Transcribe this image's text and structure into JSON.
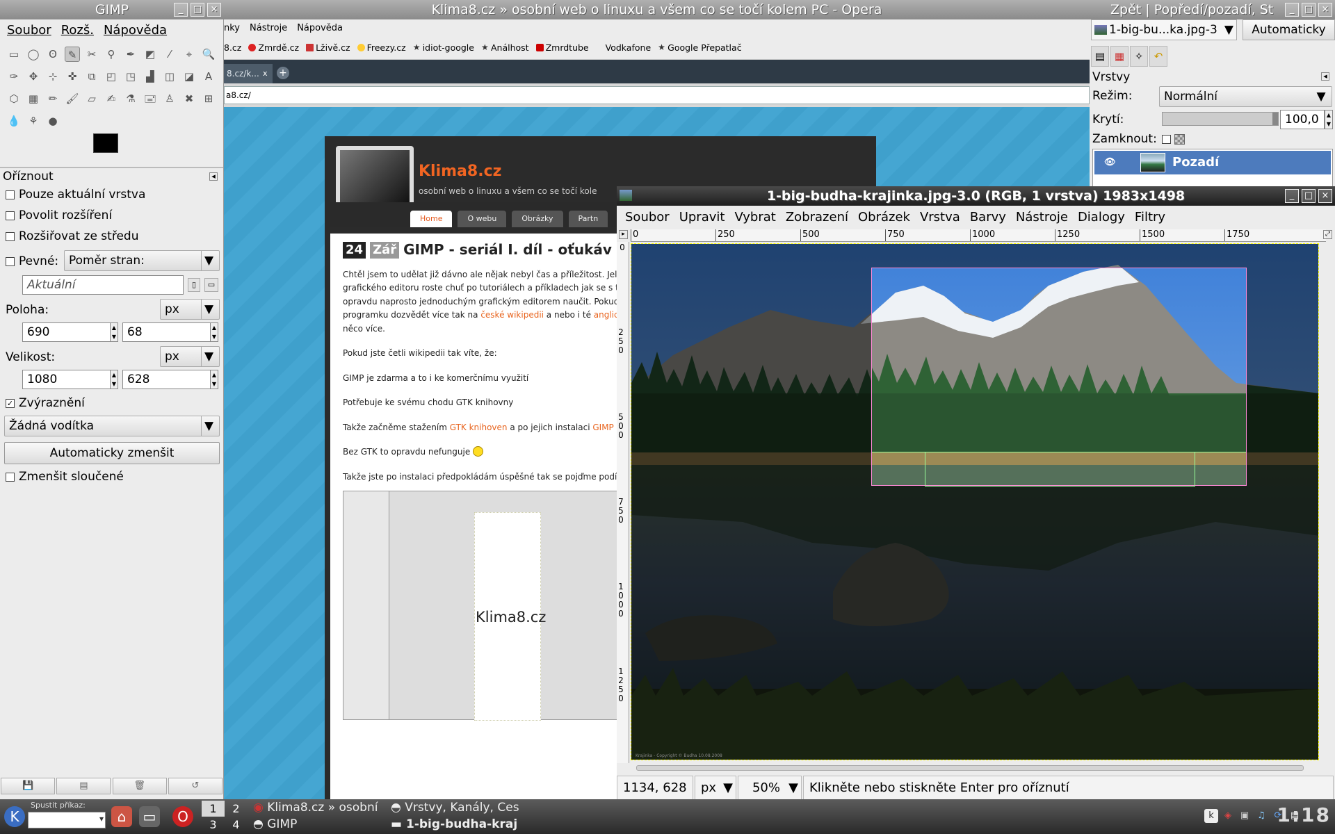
{
  "opera": {
    "title": "Klima8.cz » osobní web o linuxu a všem co se točí kolem PC - Opera",
    "menu": [
      "nky",
      "Nástroje",
      "Nápověda"
    ],
    "bookmarks": [
      "8.cz",
      "Zmrdě.cz",
      "Lživě.cz",
      "Freezy.cz",
      "idiot-google",
      "Análhost",
      "Zmrdtube",
      "Vodkafone",
      "Google Přepatlač"
    ],
    "tab_label": "8.cz/k...",
    "tab_close": "x",
    "new_tab": "+",
    "url": "a8.cz/",
    "site": {
      "title": "Klima8.cz",
      "subtitle": "osobní web o linuxu a všem co se točí kole",
      "nav": [
        "Home",
        "O webu",
        "Obrázky",
        "Partn"
      ],
      "post_day": "24",
      "post_month": "Zář",
      "post_title": "GIMP - seriál I. díl - oťukáv",
      "p1": "Chtěl jsem to udělat již dávno ale nějak nebyl čas a příležitost. Jeli",
      "p2": "grafického editoru roste chuť po tutoriálech a příkladech jak se s tím",
      "p3": "opravdu naprosto jednoduchým grafickým editorem naučit. Pokud s",
      "p4a": "programku dozvědět více tak na ",
      "p4link": "české wikipedii",
      "p4b": " a nebo i té ",
      "p4link2": "anglick",
      "p5": "něco více.",
      "p6": "Pokud jste četli wikipedii tak víte, že:",
      "p7": "GIMP je zdarma a to i ke komerčnímu využití",
      "p8": "Potřebuje ke svému chodu GTK knihovny",
      "p9a": "Takže začněme stažením ",
      "p9link": "GTK knihoven",
      "p9b": " a po jejich instalaci ",
      "p9link2": "GIMP",
      "p10": "Bez GTK to opravdu nefunguje",
      "p11": "Takže jste po instalaci předpokládám úspěšné tak se pojďme podív",
      "shot_text": "Klima8.cz"
    }
  },
  "toolbox": {
    "title": "GIMP",
    "menu": [
      "Soubor",
      "Rozš.",
      "Nápověda"
    ],
    "tools": [
      "▭",
      "◯",
      "ʘ",
      "✎",
      "✂",
      "⚲",
      "✒",
      "◩",
      "⁄",
      "⌖",
      "🔍",
      "✑",
      "✥",
      "⊹",
      "✜",
      "⧉",
      "◰",
      "◳",
      "▟",
      "◫",
      "◪",
      "A",
      "⬡",
      "▦",
      "✏",
      "🖌",
      "▱",
      "✍",
      "⚗",
      "🖃",
      "♙",
      "✖",
      "⊞",
      "💧",
      "⚘",
      "●"
    ],
    "options_title": "Oříznout",
    "only_active_layer": "Pouze aktuální vrstva",
    "allow_grow": "Povolit rozšíření",
    "expand_center": "Rozšiřovat ze středu",
    "fixed_label": "Pevné:",
    "fixed_combo": "Poměr stran:",
    "current_placeholder": "Aktuální",
    "position_label": "Poloha:",
    "position_unit": "px",
    "pos_x": "690",
    "pos_y": "68",
    "size_label": "Velikost:",
    "size_unit": "px",
    "size_w": "1080",
    "size_h": "628",
    "highlight_label": "Zvýraznění",
    "guides_combo": "Žádná vodítka",
    "autoshrink_button": "Automaticky zmenšit",
    "shrink_merged": "Zmenšit sloučené"
  },
  "layers": {
    "title": "Zpět | Popředí/pozadí, St",
    "image_combo": "1-big-bu...ka.jpg-3",
    "auto_button": "Automaticky",
    "heading": "Vrstvy",
    "mode_label": "Režim:",
    "mode_value": "Normální",
    "opacity_label": "Krytí:",
    "opacity_value": "100,0",
    "opacity_fraction": 1.0,
    "lock_label": "Zamknout:",
    "layer_name": "Pozadí"
  },
  "image_window": {
    "title": "1-big-budha-krajinka.jpg-3.0 (RGB, 1 vrstva) 1983x1498",
    "menu": [
      "Soubor",
      "Upravit",
      "Vybrat",
      "Zobrazení",
      "Obrázek",
      "Vrstva",
      "Barvy",
      "Nástroje",
      "Dialogy",
      "Filtry"
    ],
    "ruler_h": [
      "0",
      "250",
      "500",
      "750",
      "1000",
      "1250",
      "1500",
      "1750"
    ],
    "ruler_v": [
      "0",
      "250",
      "500",
      "750",
      "1000",
      "1250"
    ],
    "coords": "1134, 628",
    "unit": "px",
    "zoom": "50%",
    "status_msg": "Klikněte nebo stiskněte Enter pro oříznutí",
    "watermark": "Krajinka - Copyright © Budha 10.08.2008"
  },
  "panel": {
    "run_label": "Spustit příkaz:",
    "pager": [
      "1",
      "2",
      "3",
      "4"
    ],
    "tasks": [
      "Klima8.cz » osobní",
      "GIMP",
      "Vrstvy, Kanály, Ces",
      "1-big-budha-kraj"
    ],
    "clock": "1:18"
  }
}
